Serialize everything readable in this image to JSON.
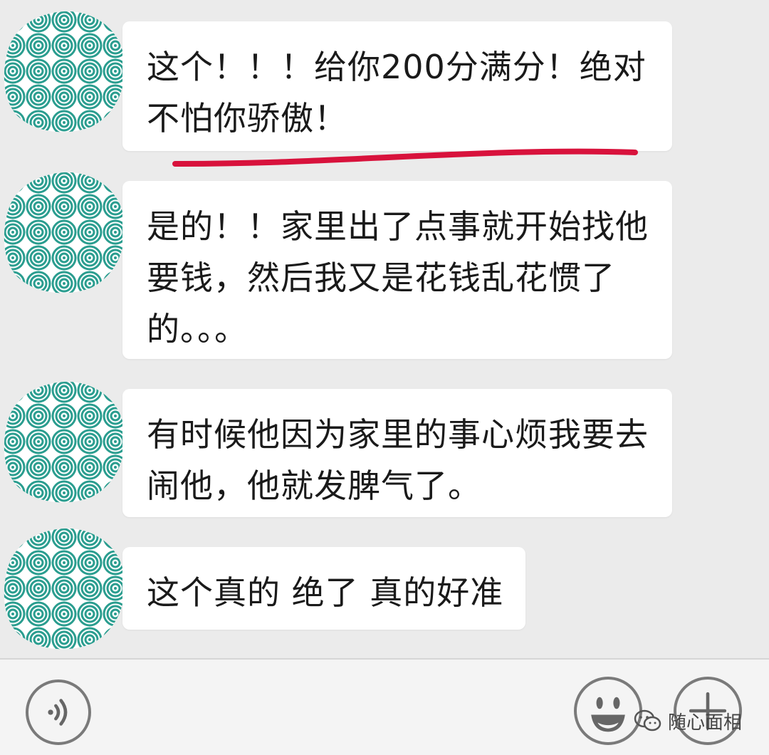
{
  "messages": [
    {
      "lines": [
        "这个！！！给你200分满分！绝对",
        "不怕你骄傲！"
      ]
    },
    {
      "lines": [
        "是的！！家里出了点事就开始找他",
        "要钱，然后我又是花钱乱花惯了",
        "的。。。"
      ]
    },
    {
      "lines": [
        "有时候他因为家里的事心烦我要去",
        "闹他，他就发脾气了。"
      ]
    },
    {
      "lines": [
        "这个真的 绝了 真的好准"
      ]
    }
  ],
  "input_bar": {
    "voice_icon": "voice-icon",
    "emoji_icon": "smiley-icon",
    "plus_icon": "plus-icon"
  },
  "watermark": {
    "text": "随心面相",
    "icon": "wechat-icon"
  },
  "colors": {
    "background": "#ebebeb",
    "bubble": "#ffffff",
    "underline": "#d8123c",
    "avatar": "#2a9d8f"
  }
}
